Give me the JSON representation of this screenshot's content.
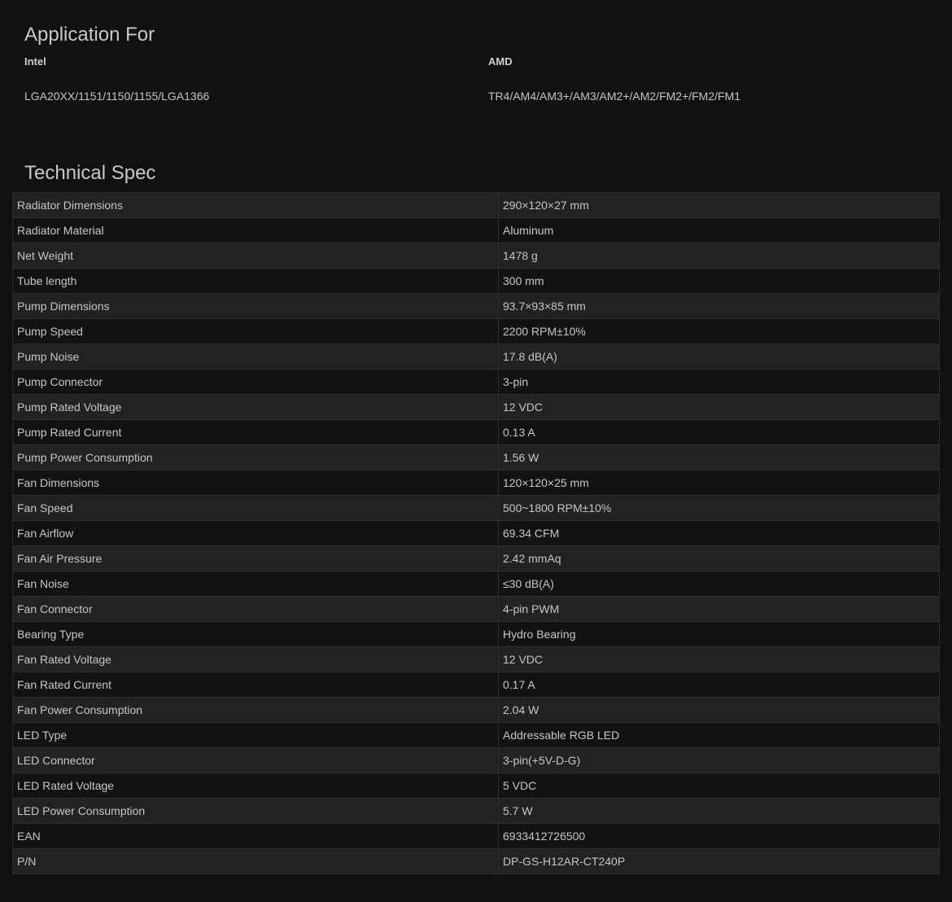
{
  "application": {
    "title": "Application For",
    "intel": {
      "brand": "Intel",
      "sockets": "LGA20XX/1151/1150/1155/LGA1366"
    },
    "amd": {
      "brand": "AMD",
      "sockets": "TR4/AM4/AM3+/AM3/AM2+/AM2/FM2+/FM2/FM1"
    }
  },
  "spec": {
    "title": "Technical Spec",
    "rows": [
      {
        "label": "Radiator Dimensions",
        "value": "290×120×27 mm"
      },
      {
        "label": "Radiator Material",
        "value": "Aluminum"
      },
      {
        "label": "Net Weight",
        "value": "1478 g"
      },
      {
        "label": "Tube length",
        "value": "300 mm"
      },
      {
        "label": "Pump Dimensions",
        "value": "93.7×93×85 mm"
      },
      {
        "label": "Pump Speed",
        "value": "2200 RPM±10%"
      },
      {
        "label": "Pump Noise",
        "value": "17.8 dB(A)"
      },
      {
        "label": "Pump Connector",
        "value": "3-pin"
      },
      {
        "label": "Pump Rated Voltage",
        "value": "12 VDC"
      },
      {
        "label": "Pump Rated Current",
        "value": "0.13 A"
      },
      {
        "label": "Pump Power Consumption",
        "value": "1.56 W"
      },
      {
        "label": "Fan Dimensions",
        "value": "120×120×25 mm"
      },
      {
        "label": "Fan Speed",
        "value": "500~1800 RPM±10%"
      },
      {
        "label": "Fan Airflow",
        "value": "69.34 CFM"
      },
      {
        "label": "Fan Air Pressure",
        "value": "2.42 mmAq"
      },
      {
        "label": "Fan Noise",
        "value": "≤30 dB(A)"
      },
      {
        "label": "Fan Connector",
        "value": "4-pin PWM"
      },
      {
        "label": "Bearing Type",
        "value": "Hydro Bearing"
      },
      {
        "label": "Fan Rated Voltage",
        "value": "12 VDC"
      },
      {
        "label": "Fan Rated Current",
        "value": "0.17 A"
      },
      {
        "label": "Fan Power Consumption",
        "value": "2.04 W"
      },
      {
        "label": "LED Type",
        "value": "Addressable RGB LED"
      },
      {
        "label": "LED Connector",
        "value": "3-pin(+5V-D-G)"
      },
      {
        "label": "LED Rated Voltage",
        "value": "5 VDC"
      },
      {
        "label": "LED Power Consumption",
        "value": "5.7 W"
      },
      {
        "label": "EAN",
        "value": "6933412726500"
      },
      {
        "label": "P/N",
        "value": "DP-GS-H12AR-CT240P"
      }
    ]
  }
}
